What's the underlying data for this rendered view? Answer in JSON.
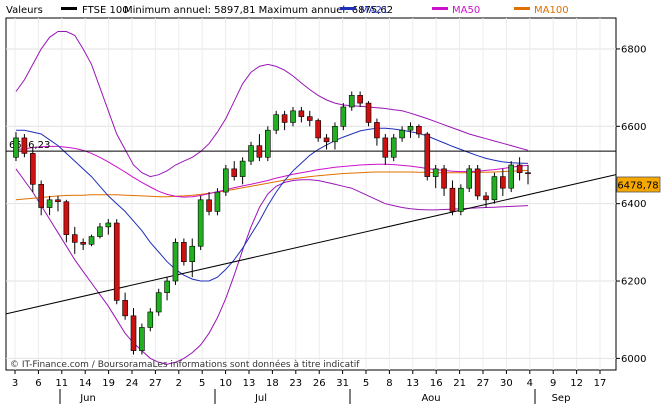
{
  "header": {
    "label": "Valeurs",
    "instrument": "FTSE 100",
    "minmax": "Minimum annuel: 5897,81 Maximum annuel: 6875,62",
    "legend": [
      {
        "name": "MA21",
        "color": "#1f2fb8"
      },
      {
        "name": "MA50",
        "color": "#cc11cc"
      },
      {
        "name": "MA100",
        "color": "#e07000"
      }
    ]
  },
  "footer": {
    "credit": "© IT-Finance.com / BoursoramaLes informations sont données à titre indicatif"
  },
  "chart_data": {
    "type": "candlestick",
    "title": "FTSE 100",
    "ylim": [
      5970,
      6880
    ],
    "y_ticks": [
      "6000",
      "6200",
      "6400",
      "6600",
      "6800"
    ],
    "x_tick_labels": [
      "3",
      "6",
      "11",
      "14",
      "19",
      "24",
      "27",
      "2",
      "5",
      "10",
      "13",
      "18",
      "23",
      "26",
      "31",
      "5",
      "8",
      "13",
      "16",
      "21",
      "27",
      "30",
      "4",
      "9",
      "12",
      "17"
    ],
    "month_labels": [
      "Jun",
      "Jul",
      "Aou",
      "Sep"
    ],
    "current_value": "6478,78",
    "reference_level": {
      "label": "6536,23",
      "value": 6536
    },
    "candles": [
      [
        6520,
        6585,
        6510,
        6570
      ],
      [
        6570,
        6580,
        6520,
        6530
      ],
      [
        6530,
        6545,
        6430,
        6450
      ],
      [
        6450,
        6460,
        6370,
        6390
      ],
      [
        6390,
        6420,
        6370,
        6410
      ],
      [
        6410,
        6420,
        6380,
        6405
      ],
      [
        6405,
        6410,
        6300,
        6320
      ],
      [
        6320,
        6340,
        6270,
        6300
      ],
      [
        6300,
        6310,
        6280,
        6295
      ],
      [
        6295,
        6320,
        6290,
        6315
      ],
      [
        6315,
        6350,
        6310,
        6340
      ],
      [
        6340,
        6360,
        6320,
        6350
      ],
      [
        6350,
        6360,
        6140,
        6150
      ],
      [
        6150,
        6170,
        6100,
        6110
      ],
      [
        6110,
        6130,
        6010,
        6020
      ],
      [
        6020,
        6090,
        6010,
        6080
      ],
      [
        6080,
        6130,
        6070,
        6120
      ],
      [
        6120,
        6180,
        6110,
        6170
      ],
      [
        6170,
        6210,
        6150,
        6200
      ],
      [
        6200,
        6310,
        6190,
        6300
      ],
      [
        6300,
        6310,
        6240,
        6250
      ],
      [
        6250,
        6310,
        6210,
        6290
      ],
      [
        6290,
        6420,
        6280,
        6410
      ],
      [
        6410,
        6430,
        6370,
        6380
      ],
      [
        6380,
        6440,
        6370,
        6430
      ],
      [
        6430,
        6500,
        6420,
        6490
      ],
      [
        6490,
        6510,
        6460,
        6470
      ],
      [
        6470,
        6520,
        6450,
        6510
      ],
      [
        6510,
        6560,
        6500,
        6550
      ],
      [
        6550,
        6580,
        6510,
        6520
      ],
      [
        6520,
        6600,
        6510,
        6590
      ],
      [
        6590,
        6640,
        6580,
        6630
      ],
      [
        6630,
        6640,
        6590,
        6610
      ],
      [
        6610,
        6650,
        6600,
        6640
      ],
      [
        6640,
        6650,
        6610,
        6625
      ],
      [
        6625,
        6640,
        6600,
        6615
      ],
      [
        6615,
        6620,
        6560,
        6570
      ],
      [
        6570,
        6580,
        6540,
        6560
      ],
      [
        6560,
        6610,
        6540,
        6600
      ],
      [
        6600,
        6660,
        6590,
        6650
      ],
      [
        6650,
        6690,
        6640,
        6680
      ],
      [
        6680,
        6690,
        6650,
        6660
      ],
      [
        6660,
        6665,
        6600,
        6610
      ],
      [
        6610,
        6620,
        6550,
        6570
      ],
      [
        6570,
        6580,
        6500,
        6520
      ],
      [
        6520,
        6580,
        6510,
        6570
      ],
      [
        6570,
        6600,
        6560,
        6590
      ],
      [
        6590,
        6610,
        6570,
        6600
      ],
      [
        6600,
        6605,
        6570,
        6580
      ],
      [
        6580,
        6585,
        6460,
        6470
      ],
      [
        6470,
        6500,
        6440,
        6490
      ],
      [
        6490,
        6500,
        6420,
        6440
      ],
      [
        6440,
        6460,
        6370,
        6380
      ],
      [
        6380,
        6450,
        6370,
        6440
      ],
      [
        6440,
        6500,
        6430,
        6490
      ],
      [
        6490,
        6500,
        6410,
        6420
      ],
      [
        6420,
        6430,
        6390,
        6410
      ],
      [
        6410,
        6480,
        6400,
        6470
      ],
      [
        6470,
        6490,
        6420,
        6440
      ],
      [
        6440,
        6510,
        6430,
        6500
      ],
      [
        6500,
        6520,
        6460,
        6480
      ],
      [
        6480,
        6500,
        6450,
        6478
      ]
    ],
    "ma21": [
      6590,
      6590,
      6585,
      6580,
      6565,
      6550,
      6530,
      6510,
      6490,
      6470,
      6445,
      6420,
      6400,
      6380,
      6355,
      6330,
      6300,
      6275,
      6250,
      6230,
      6215,
      6205,
      6200,
      6200,
      6210,
      6230,
      6255,
      6285,
      6320,
      6355,
      6395,
      6430,
      6460,
      6485,
      6505,
      6525,
      6540,
      6552,
      6563,
      6572,
      6580,
      6588,
      6592,
      6595,
      6595,
      6593,
      6590,
      6586,
      6582,
      6575,
      6566,
      6557,
      6548,
      6540,
      6532,
      6524,
      6517,
      6512,
      6508,
      6506,
      6505,
      6504
    ],
    "ma50": [
      6540,
      6542,
      6545,
      6547,
      6548,
      6548,
      6546,
      6543,
      6538,
      6530,
      6520,
      6508,
      6495,
      6482,
      6468,
      6455,
      6443,
      6432,
      6424,
      6419,
      6417,
      6418,
      6421,
      6426,
      6431,
      6436,
      6441,
      6446,
      6450,
      6455,
      6460,
      6466,
      6471,
      6476,
      6480,
      6484,
      6488,
      6491,
      6494,
      6496,
      6498,
      6500,
      6501,
      6502,
      6502,
      6501,
      6499,
      6497,
      6494,
      6491,
      6488,
      6486,
      6484,
      6483,
      6483,
      6484,
      6486,
      6488,
      6491,
      6494,
      6497,
      6499
    ],
    "ma100": [
      6410,
      6412,
      6414,
      6416,
      6418,
      6420,
      6421,
      6422,
      6422,
      6423,
      6423,
      6423,
      6423,
      6422,
      6421,
      6420,
      6419,
      6418,
      6418,
      6419,
      6420,
      6422,
      6424,
      6427,
      6430,
      6433,
      6437,
      6441,
      6445,
      6449,
      6453,
      6457,
      6461,
      6464,
      6467,
      6470,
      6472,
      6474,
      6476,
      6478,
      6479,
      6480,
      6481,
      6482,
      6482,
      6482,
      6482,
      6482,
      6481,
      6481,
      6480,
      6480,
      6480,
      6480,
      6480,
      6481,
      6481,
      6482,
      6483,
      6484,
      6485,
      6486
    ],
    "bollinger_upper": [
      6690,
      6720,
      6760,
      6800,
      6830,
      6845,
      6845,
      6835,
      6800,
      6760,
      6700,
      6640,
      6580,
      6540,
      6500,
      6480,
      6470,
      6475,
      6485,
      6500,
      6510,
      6520,
      6535,
      6555,
      6585,
      6620,
      6665,
      6710,
      6740,
      6755,
      6760,
      6755,
      6745,
      6730,
      6712,
      6695,
      6680,
      6668,
      6660,
      6655,
      6653,
      6652,
      6650,
      6648,
      6646,
      6643,
      6640,
      6634,
      6627,
      6620,
      6612,
      6604,
      6596,
      6588,
      6580,
      6574,
      6568,
      6562,
      6556,
      6550,
      6544,
      6538
    ],
    "bollinger_lower": [
      6490,
      6460,
      6430,
      6395,
      6360,
      6325,
      6290,
      6255,
      6225,
      6195,
      6165,
      6135,
      6100,
      6065,
      6040,
      6020,
      6000,
      5990,
      5985,
      5990,
      6000,
      6015,
      6035,
      6065,
      6105,
      6155,
      6215,
      6280,
      6340,
      6390,
      6425,
      6445,
      6455,
      6460,
      6462,
      6462,
      6460,
      6455,
      6450,
      6445,
      6440,
      6430,
      6420,
      6410,
      6400,
      6395,
      6390,
      6387,
      6385,
      6384,
      6384,
      6385,
      6386,
      6387,
      6388,
      6389,
      6390,
      6391,
      6392,
      6393,
      6394,
      6395
    ],
    "trendline": {
      "x_start_label": "3 Jun",
      "x_end_label": "4 Sep",
      "y_start": 6115,
      "y_end": 6475
    }
  }
}
